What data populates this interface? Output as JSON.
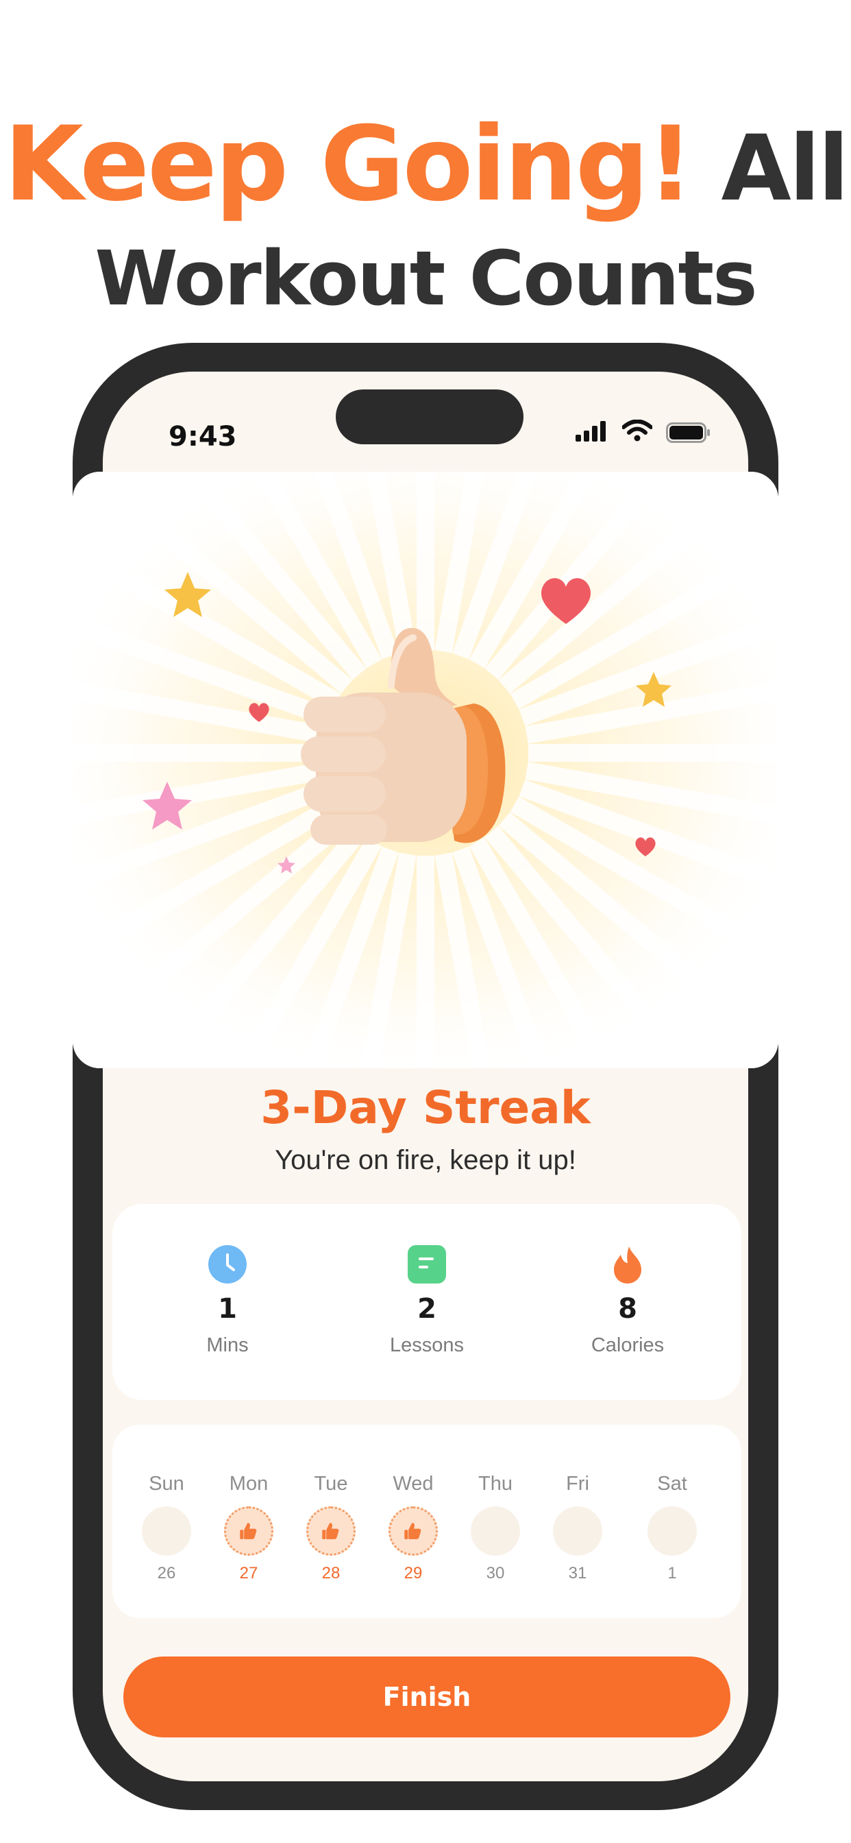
{
  "headline": {
    "accent": "Keep Going!",
    "line1_rest": "All",
    "line2": "Workout Counts"
  },
  "status_bar": {
    "time": "9:43",
    "icons": [
      "cellular-signal-icon",
      "wifi-icon",
      "battery-icon"
    ]
  },
  "hero": {
    "illustration": "thumbs-up-icon",
    "decorations": [
      "star-icon",
      "heart-icon"
    ]
  },
  "streak": {
    "title": "3-Day Streak",
    "subtitle": "You're on fire, keep it up!"
  },
  "stats": [
    {
      "icon": "clock-icon",
      "value": "1",
      "label": "Mins",
      "color": "#6fb9f5"
    },
    {
      "icon": "lessons-icon",
      "value": "2",
      "label": "Lessons",
      "color": "#57d28a"
    },
    {
      "icon": "flame-icon",
      "value": "8",
      "label": "Calories",
      "color": "#f77a3a"
    }
  ],
  "week": [
    {
      "day": "Sun",
      "date": "26",
      "done": false
    },
    {
      "day": "Mon",
      "date": "27",
      "done": true
    },
    {
      "day": "Tue",
      "date": "28",
      "done": true
    },
    {
      "day": "Wed",
      "date": "29",
      "done": true
    },
    {
      "day": "Thu",
      "date": "30",
      "done": false
    },
    {
      "day": "Fri",
      "date": "31",
      "done": false
    },
    {
      "day": "Sat",
      "date": "1",
      "done": false
    }
  ],
  "finish_button": {
    "label": "Finish"
  },
  "colors": {
    "accent": "#f86e2b",
    "headline_dark": "#333333",
    "screen_bg": "#fbf6ef"
  }
}
